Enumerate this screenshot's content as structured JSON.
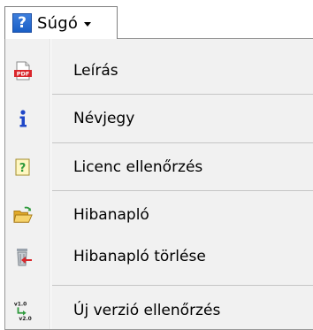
{
  "menubar": {
    "help_icon_glyph": "?",
    "help_label": "Súgó",
    "help_icon": "help-icon",
    "caret_icon": "chevron-down-icon"
  },
  "menu": {
    "items": [
      {
        "label": "Leírás",
        "icon": "pdf-icon"
      },
      {
        "label": "Névjegy",
        "icon": "info-icon"
      },
      {
        "label": "Licenc ellenőrzés",
        "icon": "license-question-icon"
      },
      {
        "label": "Hibanapló",
        "icon": "folder-open-icon"
      },
      {
        "label": "Hibanapló törlése",
        "icon": "trash-delete-icon"
      },
      {
        "label": "Új verzió ellenőrzés",
        "icon": "version-update-icon",
        "icon_text_top": "v1.0",
        "icon_text_bottom": "v2.0"
      }
    ],
    "separators_after": [
      0,
      1,
      2,
      4
    ]
  },
  "colors": {
    "help_blue": "#1a5fc6",
    "pdf_red": "#d9262b",
    "info_blue": "#1f47c8",
    "folder_yellow": "#f2c94c",
    "arrow_green": "#2e9a3c"
  }
}
